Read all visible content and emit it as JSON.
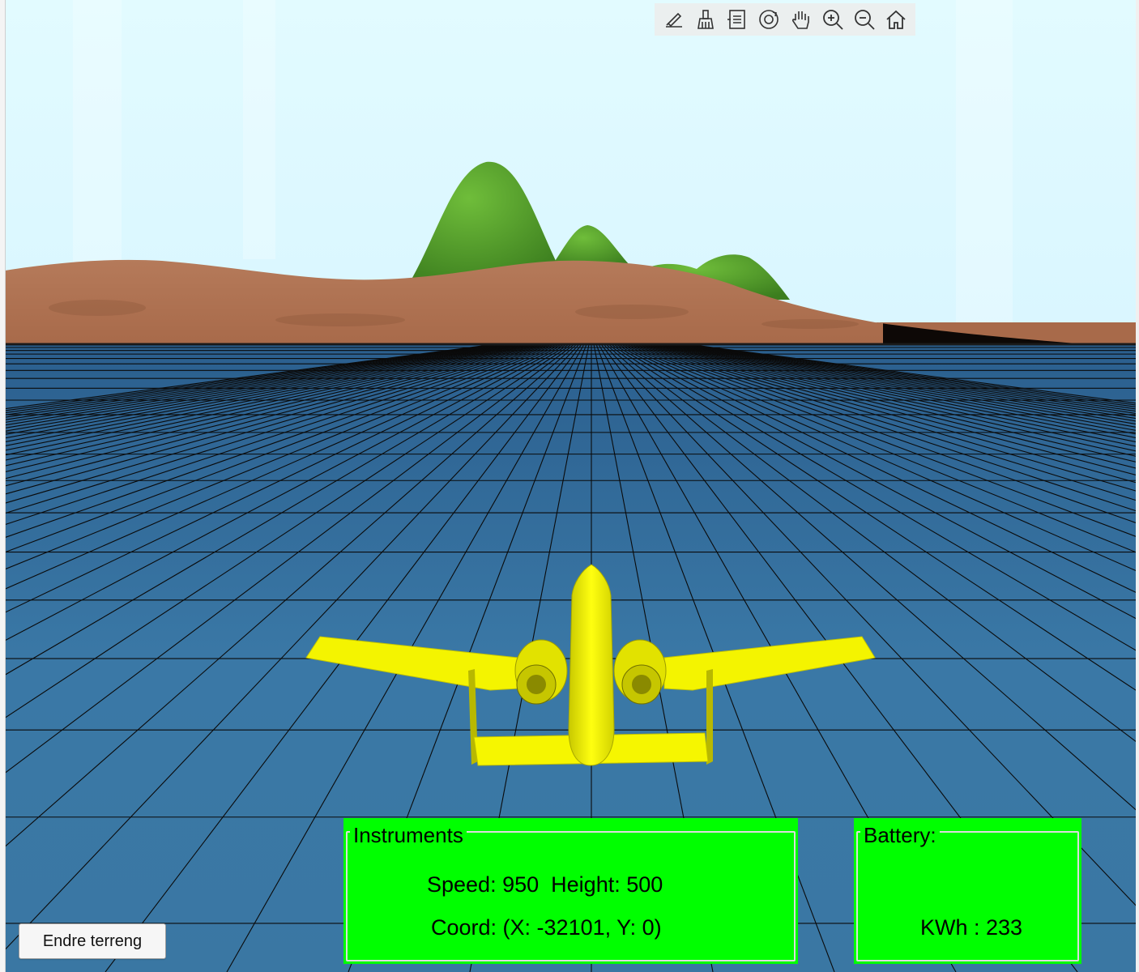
{
  "toolbar": {
    "tools": [
      {
        "name": "brush-data-icon"
      },
      {
        "name": "clean-icon"
      },
      {
        "name": "legend-icon"
      },
      {
        "name": "rotate-3d-icon"
      },
      {
        "name": "pan-hand-icon"
      },
      {
        "name": "zoom-in-icon"
      },
      {
        "name": "zoom-out-icon"
      },
      {
        "name": "home-icon"
      }
    ]
  },
  "instruments": {
    "title": "Instruments",
    "speed_label": "Speed:",
    "speed_value": "950",
    "height_label": "Height:",
    "height_value": "500",
    "coord_text": "Coord: (X: -32101, Y: 0)"
  },
  "battery": {
    "title": "Battery:",
    "kwh_text": "KWh : 233"
  },
  "buttons": {
    "change_terrain": "Endre terreng"
  },
  "colors": {
    "sky": "#e6fbff",
    "ground": "#2f6d9b",
    "hill_dirt": "#b87a58",
    "hill_grass": "#5aa32c",
    "aircraft": "#f2f200",
    "panel": "#00ff00"
  }
}
